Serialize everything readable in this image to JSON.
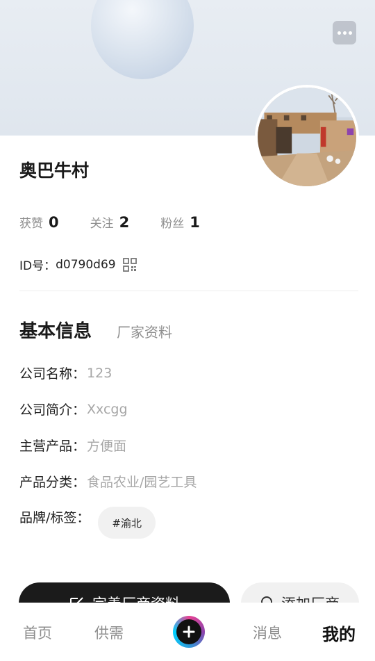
{
  "profile": {
    "name": "奥巴牛村",
    "id_label": "ID号：",
    "id_value": "d0790d69"
  },
  "stats": [
    {
      "label": "获赞",
      "value": "0"
    },
    {
      "label": "关注",
      "value": "2"
    },
    {
      "label": "粉丝",
      "value": "1"
    }
  ],
  "tabs": {
    "basic": "基本信息",
    "factory": "厂家资料"
  },
  "info": {
    "company_name": {
      "label": "公司名称：",
      "value": "123"
    },
    "company_intro": {
      "label": "公司简介：",
      "value": "Xxcgg"
    },
    "main_products": {
      "label": "主营产品：",
      "value": "方便面"
    },
    "product_category": {
      "label": "产品分类：",
      "value": "食品农业/园艺工具"
    },
    "brand_tags": {
      "label": "品牌/标签：",
      "tags": [
        "#渝北"
      ]
    }
  },
  "actions": {
    "complete_profile": "完善厂商资料",
    "add_vendor": "添加厂商"
  },
  "tabbar": {
    "home": "首页",
    "supply": "供需",
    "messages": "消息",
    "mine": "我的"
  },
  "icons": {
    "more": "more-icon",
    "qr": "qr-code-icon",
    "edit": "edit-icon",
    "search": "search-icon",
    "plus": "plus-icon"
  }
}
